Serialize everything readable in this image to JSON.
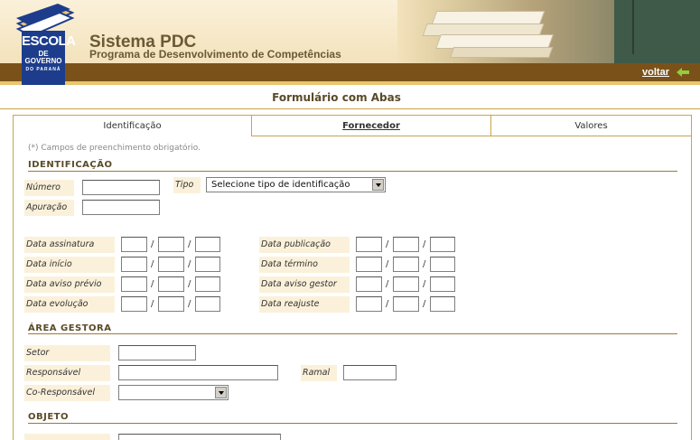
{
  "header": {
    "title": "Sistema PDC",
    "subtitle": "Programa de Desenvolvimento de Competências",
    "logo": {
      "line1": "ESCOLA",
      "line2": "DE GOVERNO",
      "line3": "DO PARANÁ"
    },
    "back_link": "voltar",
    "back_icon": "arrow-left-icon"
  },
  "form_title": "Formulário com Abas",
  "tabs": [
    {
      "label": "Identificação",
      "state": "active"
    },
    {
      "label": "Fornecedor",
      "state": "link"
    },
    {
      "label": "Valores",
      "state": "inactive"
    }
  ],
  "note": "(*) Campos de preenchimento obrigatório.",
  "identificacao": {
    "heading": "IDENTIFICAÇÃO",
    "numero_label": "Número",
    "tipo_label": "Tipo",
    "tipo_value": "Selecione tipo de identificação",
    "apuracao_label": "Apuração"
  },
  "dates": {
    "left": [
      "Data assinatura",
      "Data início",
      "Data aviso prévio",
      "Data evolução"
    ],
    "right": [
      "Data publicação",
      "Data término",
      "Data aviso gestor",
      "Data reajuste"
    ],
    "separator": "/"
  },
  "area_gestora": {
    "heading": "ÁREA GESTORA",
    "setor_label": "Setor",
    "responsavel_label": "Responsável",
    "ramal_label": "Ramal",
    "coresponsavel_label": "Co-Responsável",
    "coresponsavel_value": ""
  },
  "objeto": {
    "heading": "OBJETO"
  },
  "colors": {
    "brown_bar": "#7a5219",
    "gold": "#e9c76d",
    "label_bg": "#fbf1da",
    "title_text": "#6b5a33",
    "logo_blue": "#1d3d8c"
  }
}
